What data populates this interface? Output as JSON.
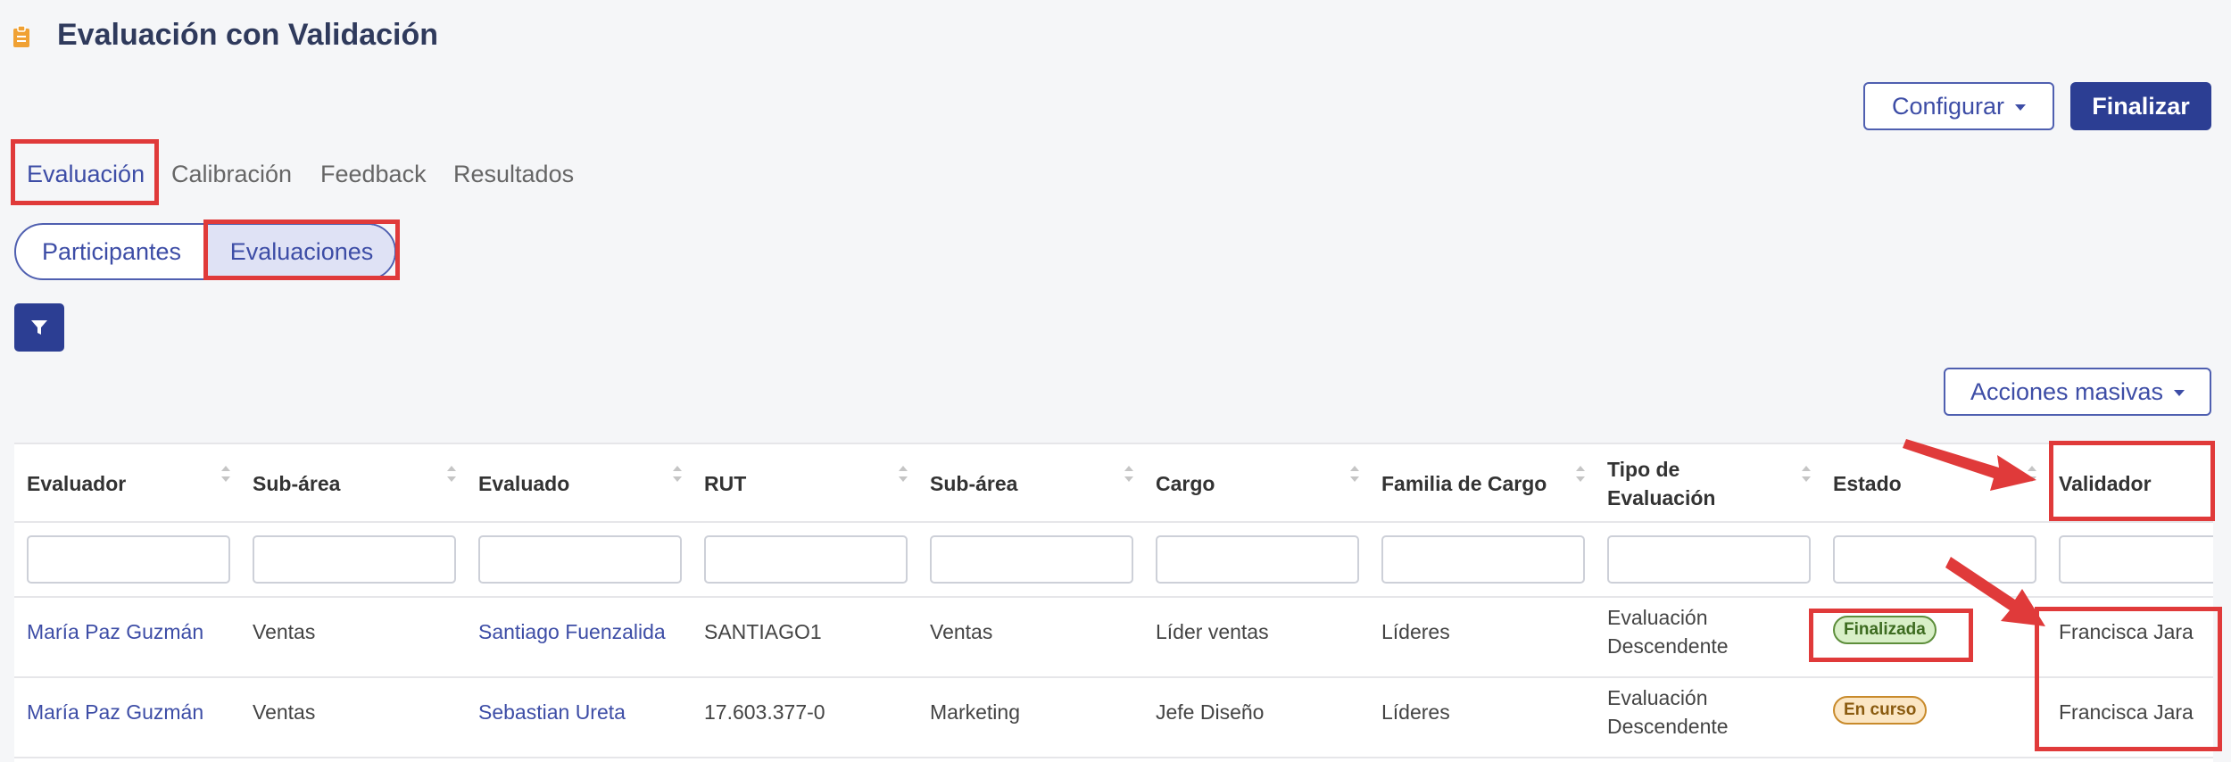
{
  "header": {
    "title": "Evaluación con Validación"
  },
  "toolbar": {
    "configure_label": "Configurar",
    "finish_label": "Finalizar"
  },
  "tabs": [
    {
      "label": "Evaluación",
      "active": true
    },
    {
      "label": "Calibración",
      "active": false
    },
    {
      "label": "Feedback",
      "active": false
    },
    {
      "label": "Resultados",
      "active": false
    }
  ],
  "segmented": [
    {
      "label": "Participantes",
      "selected": false
    },
    {
      "label": "Evaluaciones",
      "selected": true
    }
  ],
  "bulk_actions_label": "Acciones masivas",
  "table": {
    "columns": [
      "Evaluador",
      "Sub-área",
      "Evaluado",
      "RUT",
      "Sub-área",
      "Cargo",
      "Familia de Cargo",
      "Tipo de Evaluación",
      "Estado",
      "Validador"
    ],
    "rows": [
      {
        "evaluador": "María Paz Guzmán",
        "subarea1": "Ventas",
        "evaluado": "Santiago Fuenzalida",
        "rut": "SANTIAGO1",
        "subarea2": "Ventas",
        "cargo": "Líder ventas",
        "familia": "Líderes",
        "tipo_line1": "Evaluación",
        "tipo_line2": "Descendente",
        "estado": "Finalizada",
        "validador": "Francisca Jara"
      },
      {
        "evaluador": "María Paz Guzmán",
        "subarea1": "Ventas",
        "evaluado": "Sebastian Ureta",
        "rut": "17.603.377-0",
        "subarea2": "Marketing",
        "cargo": "Jefe Diseño",
        "familia": "Líderes",
        "tipo_line1": "Evaluación",
        "tipo_line2": "Descendente",
        "estado": "En curso",
        "validador": "Francisca Jara"
      }
    ]
  },
  "colors": {
    "primary": "#2c3e93",
    "accent_text": "#3d4da6",
    "highlight": "#e03a3a",
    "status_done": "#d8efc7",
    "status_progress": "#fbe6c4"
  },
  "icons": [
    "clipboard-icon",
    "caret-down-icon",
    "filter-icon",
    "sort-icon",
    "arrow-icon"
  ]
}
